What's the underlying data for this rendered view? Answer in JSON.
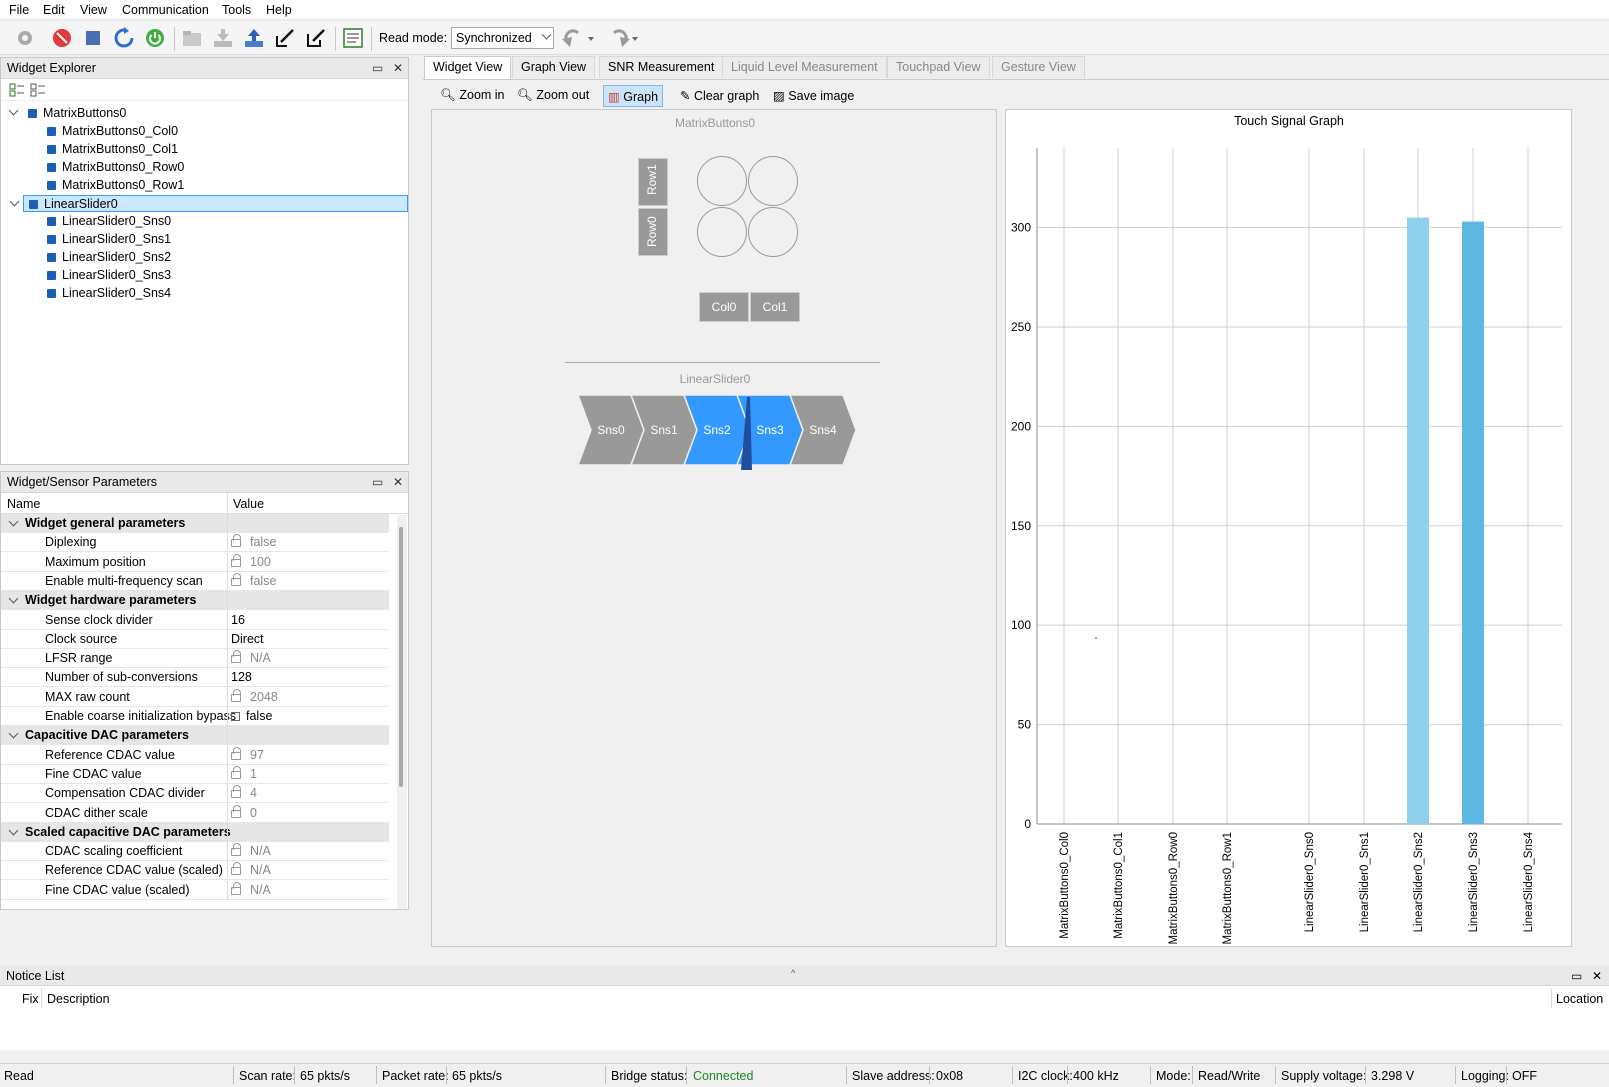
{
  "menu": [
    "File",
    "Edit",
    "View",
    "Communication",
    "Tools",
    "Help"
  ],
  "toolbar": {
    "read_mode_label": "Read mode:",
    "read_mode_value": "Synchronized"
  },
  "widget_explorer": {
    "title": "Widget Explorer",
    "items": [
      {
        "label": "MatrixButtons0",
        "level": 0
      },
      {
        "label": "MatrixButtons0_Col0",
        "level": 1
      },
      {
        "label": "MatrixButtons0_Col1",
        "level": 1
      },
      {
        "label": "MatrixButtons0_Row0",
        "level": 1
      },
      {
        "label": "MatrixButtons0_Row1",
        "level": 1
      },
      {
        "label": "LinearSlider0",
        "level": 0,
        "selected": true
      },
      {
        "label": "LinearSlider0_Sns0",
        "level": 1
      },
      {
        "label": "LinearSlider0_Sns1",
        "level": 1
      },
      {
        "label": "LinearSlider0_Sns2",
        "level": 1
      },
      {
        "label": "LinearSlider0_Sns3",
        "level": 1
      },
      {
        "label": "LinearSlider0_Sns4",
        "level": 1
      }
    ]
  },
  "params": {
    "title": "Widget/Sensor Parameters",
    "col_name": "Name",
    "col_value": "Value",
    "rows": [
      {
        "name": "Widget general parameters",
        "group": true
      },
      {
        "name": "Diplexing",
        "value": "false",
        "locked": true
      },
      {
        "name": "Maximum position",
        "value": "100",
        "locked": true
      },
      {
        "name": "Enable multi-frequency scan",
        "value": "false",
        "locked": true
      },
      {
        "name": "Widget hardware parameters",
        "group": true
      },
      {
        "name": "Sense clock divider",
        "value": "16"
      },
      {
        "name": "Clock source",
        "value": "Direct"
      },
      {
        "name": "LFSR range",
        "value": "N/A",
        "locked": true
      },
      {
        "name": "Number of sub-conversions",
        "value": "128"
      },
      {
        "name": "MAX raw count",
        "value": "2048",
        "locked": true
      },
      {
        "name": "Enable coarse initialization bypass",
        "value": "false",
        "checkbox": true
      },
      {
        "name": "Capacitive DAC parameters",
        "group": true
      },
      {
        "name": "Reference CDAC value",
        "value": "97",
        "locked": true
      },
      {
        "name": "Fine CDAC value",
        "value": "1",
        "locked": true
      },
      {
        "name": "Compensation CDAC divider",
        "value": "4",
        "locked": true
      },
      {
        "name": "CDAC dither scale",
        "value": "0",
        "locked": true
      },
      {
        "name": "Scaled capacitive DAC parameters",
        "group": true
      },
      {
        "name": "CDAC scaling coefficient",
        "value": "N/A",
        "locked": true
      },
      {
        "name": "Reference CDAC value (scaled)",
        "value": "N/A",
        "locked": true
      },
      {
        "name": "Fine CDAC value (scaled)",
        "value": "N/A",
        "locked": true
      }
    ]
  },
  "tabs": [
    "Widget View",
    "Graph View",
    "SNR Measurement",
    "Liquid Level Measurement",
    "Touchpad View",
    "Gesture View"
  ],
  "subtoolbar": {
    "zoom_in": "Zoom in",
    "zoom_out": "Zoom out",
    "graph": "Graph",
    "clear_graph": "Clear graph",
    "save_image": "Save image"
  },
  "widget_view": {
    "matrix_title": "MatrixButtons0",
    "rows": [
      "Row1",
      "Row0"
    ],
    "cols": [
      "Col0",
      "Col1"
    ],
    "slider_title": "LinearSlider0",
    "segments": [
      "Sns0",
      "Sns1",
      "Sns2",
      "Sns3",
      "Sns4"
    ],
    "active_segments": [
      "Sns2",
      "Sns3"
    ]
  },
  "chart_data": {
    "type": "bar",
    "title": "Touch Signal Graph",
    "categories": [
      "MatrixButtons0_Col0",
      "MatrixButtons0_Col1",
      "MatrixButtons0_Row0",
      "MatrixButtons0_Row1",
      "LinearSlider0_Sns0",
      "LinearSlider0_Sns1",
      "LinearSlider0_Sns2",
      "LinearSlider0_Sns3",
      "LinearSlider0_Sns4"
    ],
    "values": [
      0,
      0,
      0,
      0,
      0,
      0,
      305,
      303,
      0
    ],
    "ylim": [
      0,
      340
    ],
    "yticks": [
      0,
      50,
      100,
      150,
      200,
      250,
      300
    ],
    "colors": [
      "#8fd0ec",
      "#5cb8e0"
    ],
    "grid": true
  },
  "notice": {
    "title": "Notice List",
    "col_fix": "Fix",
    "col_desc": "Description",
    "col_loc": "Location"
  },
  "status": {
    "read": "Read",
    "scan_rate_label": "Scan rate:",
    "scan_rate": "65 pkts/s",
    "packet_rate_label": "Packet rate:",
    "packet_rate": "65 pkts/s",
    "bridge_label": "Bridge status:",
    "bridge": "Connected",
    "slave_label": "Slave address:",
    "slave": "0x08",
    "i2c_label": "I2C clock:",
    "i2c": "400 kHz",
    "mode_label": "Mode:",
    "mode": "Read/Write",
    "supply_label": "Supply voltage:",
    "supply": "3.298 V",
    "logging_label": "Logging:",
    "logging": "OFF"
  }
}
